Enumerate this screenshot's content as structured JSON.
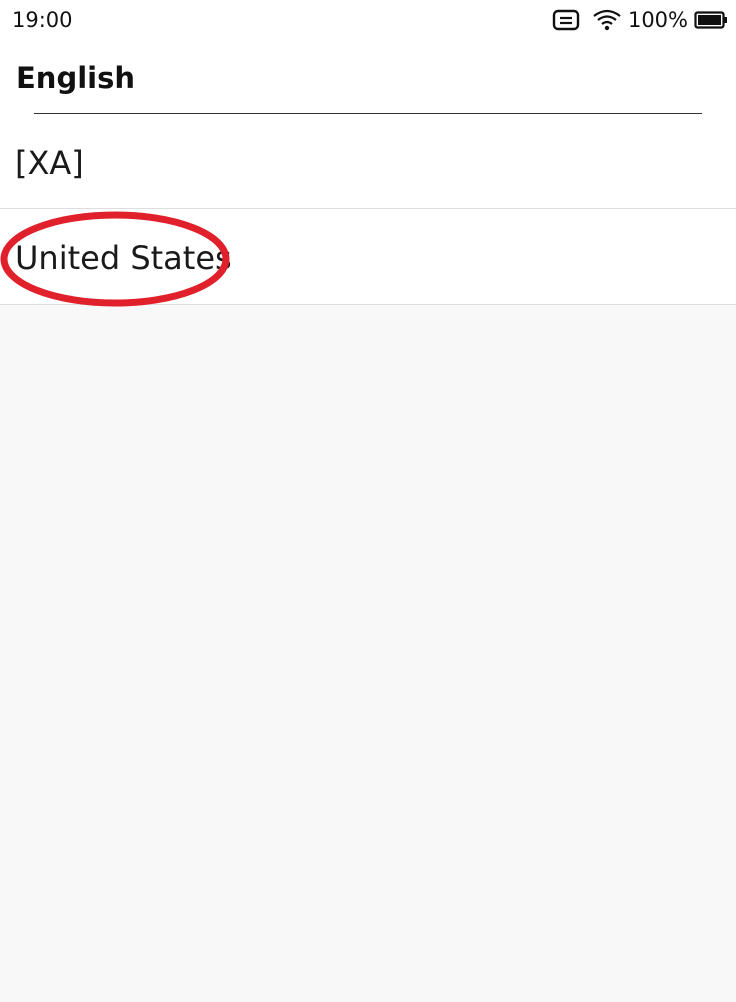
{
  "status_bar": {
    "time": "19:00",
    "battery_percent": "100%",
    "icons": [
      "notification-icon",
      "wifi-icon",
      "battery-icon"
    ]
  },
  "header": {
    "title": "English"
  },
  "list": {
    "items": [
      {
        "label": "[XA]"
      },
      {
        "label": "United States"
      }
    ]
  },
  "annotation": {
    "highlight_color": "#e0212b"
  },
  "colors": {
    "background": "#f8f8f8",
    "surface": "#ffffff",
    "divider": "#dedede"
  }
}
